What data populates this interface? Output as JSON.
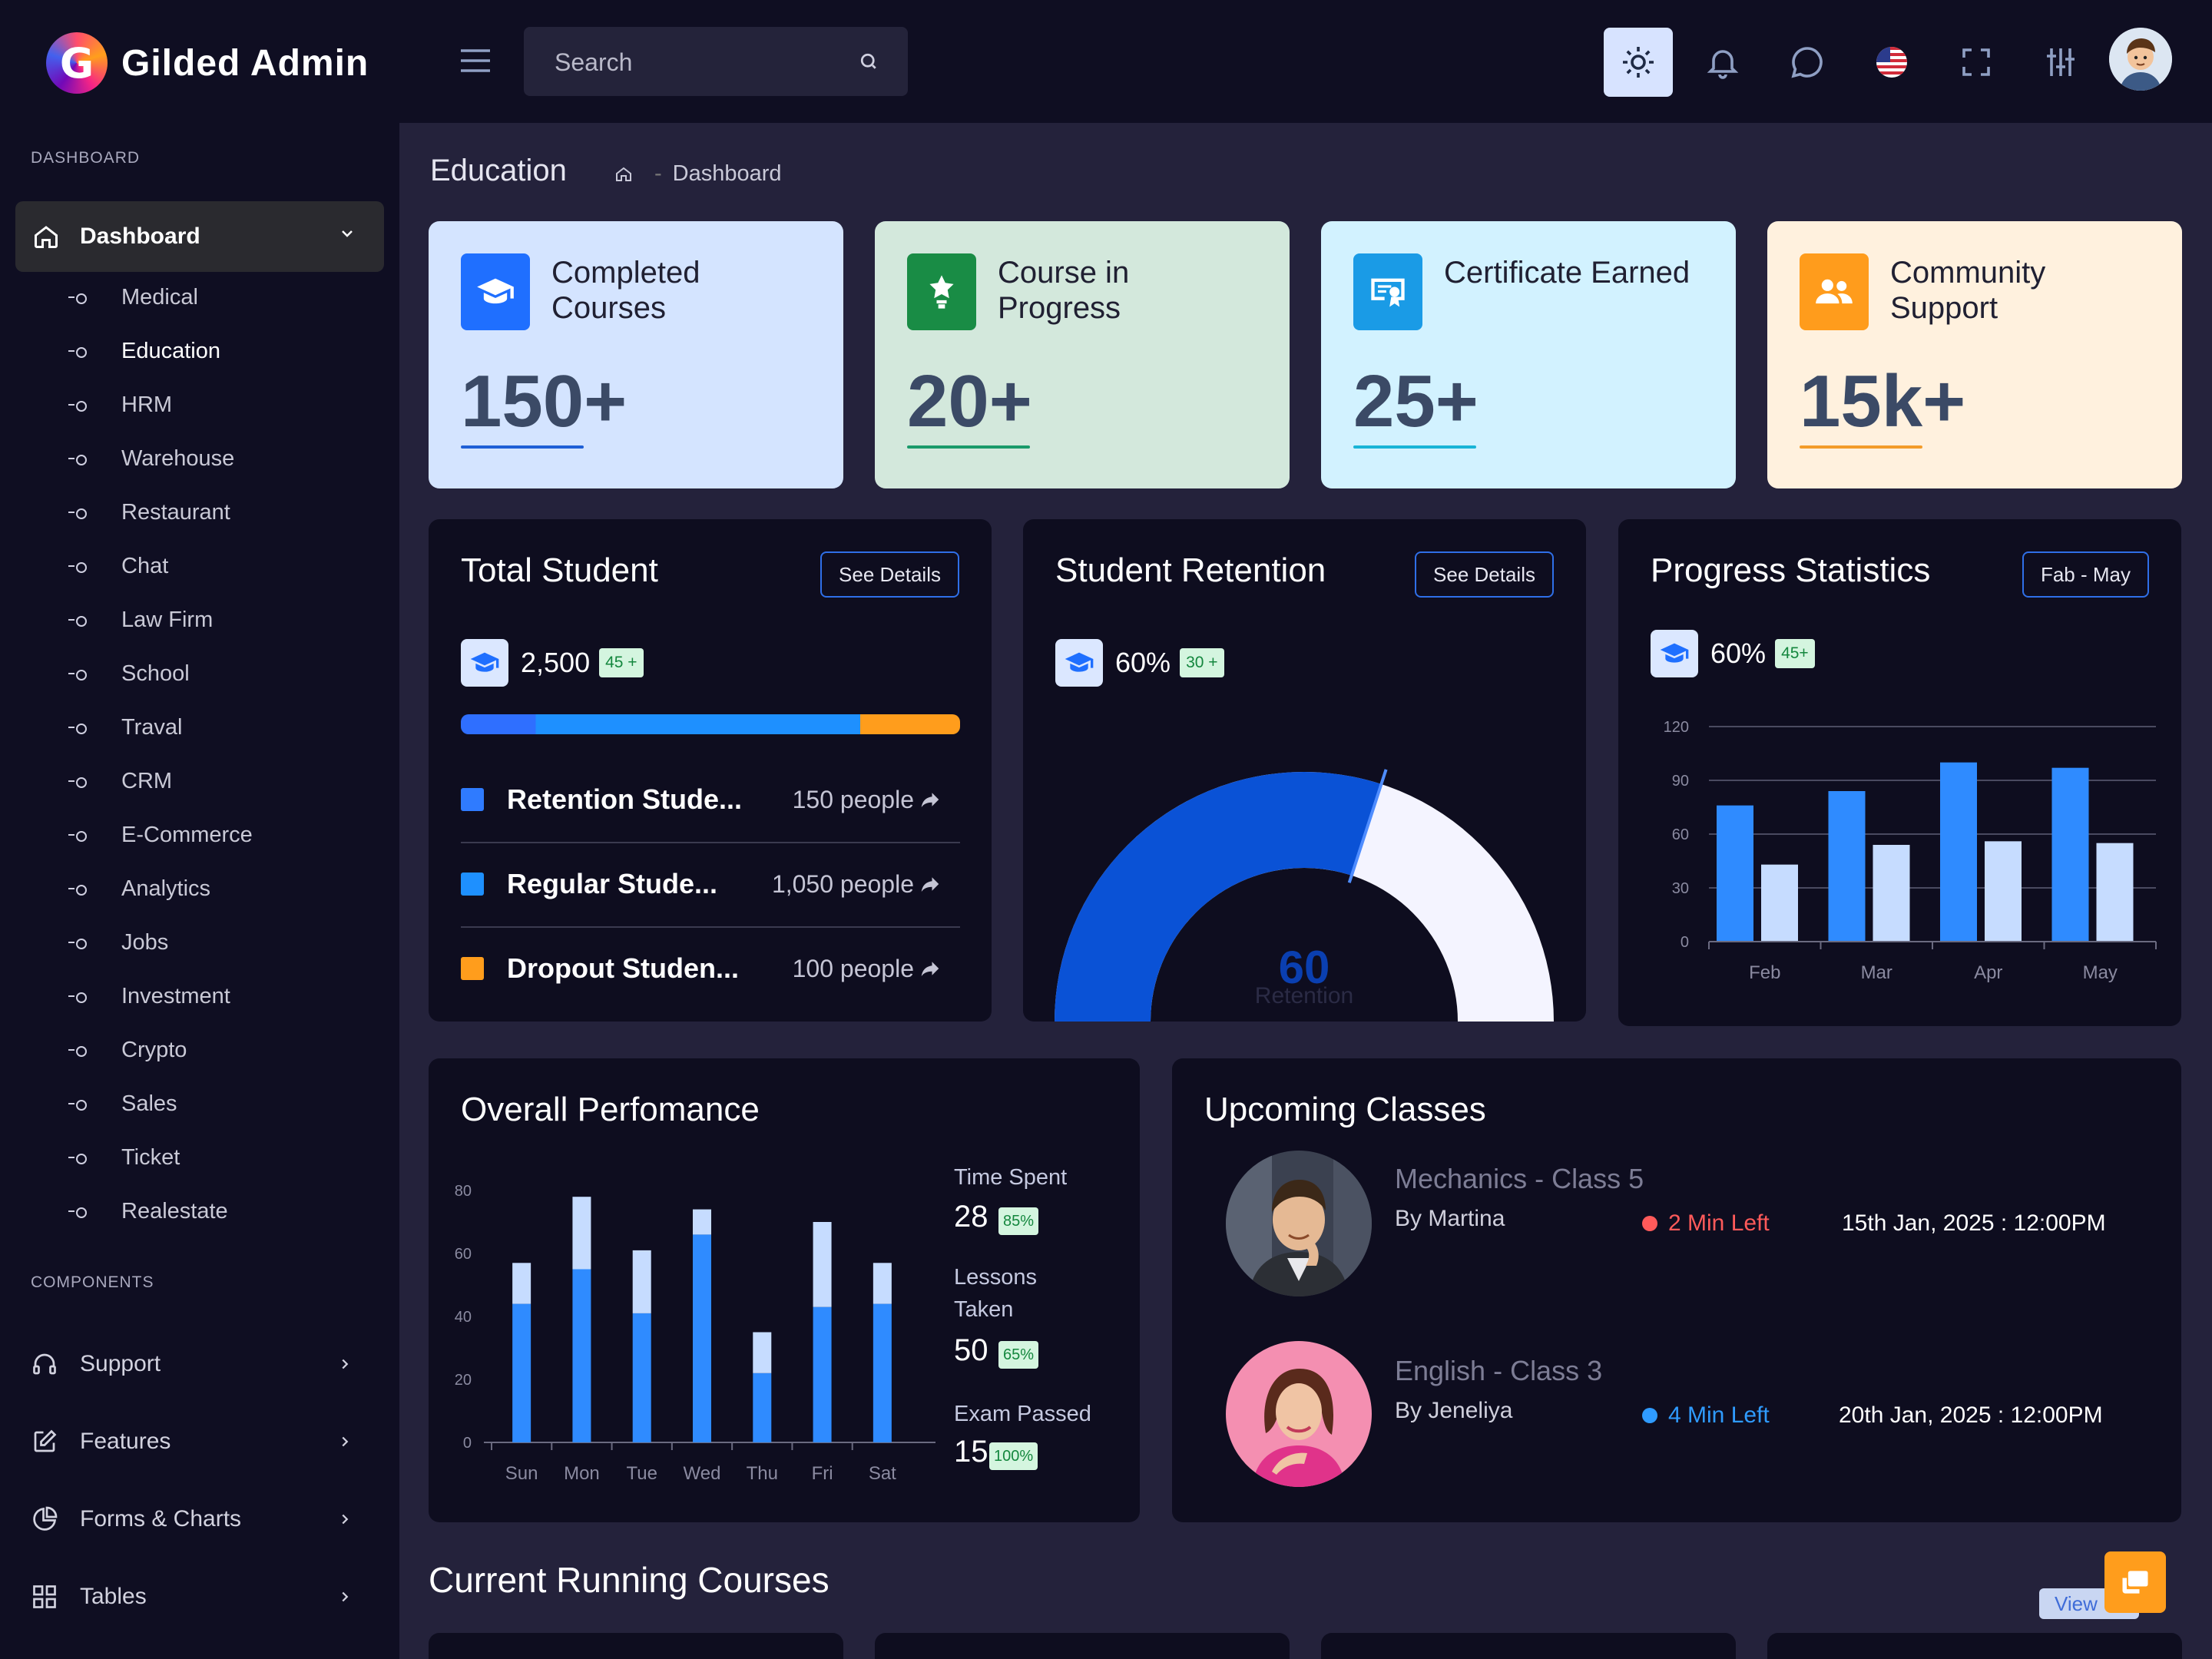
{
  "app": {
    "name": "Gilded Admin",
    "logo_letter": "G"
  },
  "sidebar": {
    "section_dashboard": "DASHBOARD",
    "active": {
      "label": "Dashboard"
    },
    "items": [
      {
        "label": "Medical"
      },
      {
        "label": "Education"
      },
      {
        "label": "HRM"
      },
      {
        "label": "Warehouse"
      },
      {
        "label": "Restaurant"
      },
      {
        "label": "Chat"
      },
      {
        "label": "Law Firm"
      },
      {
        "label": "School"
      },
      {
        "label": "Traval"
      },
      {
        "label": "CRM"
      },
      {
        "label": "E-Commerce"
      },
      {
        "label": "Analytics"
      },
      {
        "label": "Jobs"
      },
      {
        "label": "Investment"
      },
      {
        "label": "Crypto"
      },
      {
        "label": "Sales"
      },
      {
        "label": "Ticket"
      },
      {
        "label": "Realestate"
      }
    ],
    "selected_item": "Education",
    "section_components": "COMPONENTS",
    "components": [
      {
        "label": "Support",
        "icon": "headphones-icon"
      },
      {
        "label": "Features",
        "icon": "edit-icon"
      },
      {
        "label": "Forms & Charts",
        "icon": "pie-chart-icon"
      },
      {
        "label": "Tables",
        "icon": "grid-icon"
      }
    ]
  },
  "topbar": {
    "search_placeholder": "Search"
  },
  "page": {
    "title": "Education",
    "breadcrumb": "Dashboard"
  },
  "stats": [
    {
      "title": "Completed Courses",
      "value": "150+",
      "bg": "#d4e4ff",
      "icon_bg": "#1f6fff",
      "accent": "#1f5fd6",
      "icon": "graduation-cap-icon"
    },
    {
      "title": "Course in Progress",
      "value": "20+",
      "bg": "#d3e8dc",
      "icon_bg": "#198c45",
      "accent": "#1a9a6a",
      "icon": "award-icon"
    },
    {
      "title": "Certificate Earned",
      "value": "25+",
      "bg": "#d2f2ff",
      "icon_bg": "#1a9be6",
      "accent": "#19b4d6",
      "icon": "certificate-icon"
    },
    {
      "title": "Community Support",
      "value": "15k+",
      "bg": "#fff1de",
      "icon_bg": "#ff9c1c",
      "accent": "#f39c2a",
      "icon": "users-icon"
    }
  ],
  "total_student": {
    "title": "Total Student",
    "button": "See Details",
    "value": "2,500",
    "badge": "45 +",
    "rows": [
      {
        "name": "Retention Stude...",
        "value": "150 people",
        "color": "#2f7bff"
      },
      {
        "name": "Regular Stude...",
        "value": "1,050 people",
        "color": "#1e90ff"
      },
      {
        "name": "Dropout Studen...",
        "value": "100 people",
        "color": "#ff9d1c"
      }
    ],
    "bar_fractions": [
      0.15,
      0.65,
      0.2
    ]
  },
  "retention": {
    "title": "Student Retention",
    "button": "See Details",
    "value": "60%",
    "badge": "30 +",
    "gauge_value": "60",
    "gauge_label": "Retention",
    "gauge_fraction": 0.6
  },
  "progress": {
    "title": "Progress Statistics",
    "button": "Fab - May",
    "value": "60%",
    "badge": "45+"
  },
  "performance": {
    "title": "Overall Perfomance",
    "stats": [
      {
        "label": "Time Spent",
        "value": "28",
        "badge": "85%"
      },
      {
        "label": "Lessons Taken",
        "value": "50",
        "badge": "65%"
      },
      {
        "label": "Exam Passed",
        "value": "15",
        "badge": "100%"
      }
    ]
  },
  "upcoming": {
    "title": "Upcoming Classes",
    "classes": [
      {
        "name": "Mechanics - Class 5",
        "by": "By Martina",
        "left": "2 Min Left",
        "left_color": "#ff5a5a",
        "time": "15th Jan, 2025 : 12:00PM"
      },
      {
        "name": "English - Class 3",
        "by": "By Jeneliya",
        "left": "4 Min Left",
        "left_color": "#2f9bff",
        "time": "20th Jan, 2025 : 12:00PM"
      }
    ]
  },
  "current_courses": {
    "title": "Current Running Courses",
    "view": "View"
  },
  "chart_data": [
    {
      "type": "bar",
      "title": "Progress Statistics",
      "categories": [
        "Feb",
        "Mar",
        "Apr",
        "May"
      ],
      "series": [
        {
          "values": [
            76,
            84,
            100,
            97
          ],
          "color": "#2f8bff"
        },
        {
          "values": [
            43,
            54,
            56,
            55
          ],
          "color": "#c6dcff"
        }
      ],
      "ylim": [
        0,
        120
      ],
      "yticks": [
        0,
        30,
        60,
        90,
        120
      ]
    },
    {
      "type": "bar",
      "title": "Overall Perfomance",
      "stacked": true,
      "categories": [
        "Sun",
        "Mon",
        "Tue",
        "Wed",
        "Thu",
        "Fri",
        "Sat"
      ],
      "series": [
        {
          "values": [
            44,
            55,
            41,
            66,
            22,
            43,
            44
          ],
          "color": "#2f8bff"
        },
        {
          "values": [
            13,
            23,
            20,
            8,
            13,
            27,
            13
          ],
          "color": "#c6dcff"
        }
      ],
      "ylim": [
        0,
        80
      ],
      "yticks": [
        0,
        20,
        40,
        60,
        80
      ]
    }
  ]
}
